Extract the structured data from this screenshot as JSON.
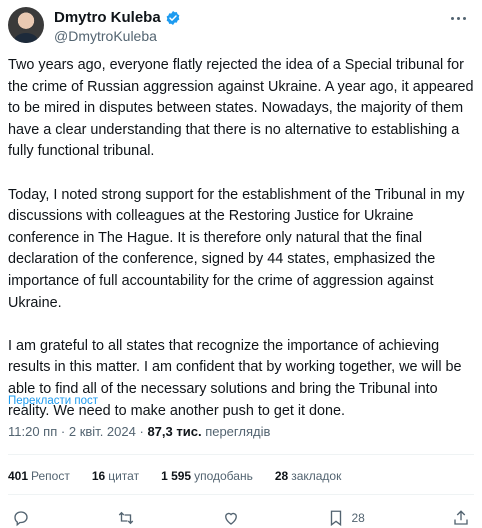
{
  "author": {
    "display_name": "Dmytro Kuleba",
    "handle": "@DmytroKuleba"
  },
  "tweet": {
    "paragraphs": [
      "Two years ago, everyone flatly rejected the idea of a Special tribunal for the crime of Russian aggression against Ukraine. A year ago, it appeared to be mired in disputes between states. Nowadays, the majority of them have a clear understanding that there is no alternative to establishing a fully functional tribunal.",
      "Today, I noted strong support for the establishment of the Tribunal in my discussions with colleagues at the Restoring Justice for Ukraine conference in The Hague. It is therefore only natural that the final declaration of the conference, signed by 44 states, emphasized the importance of full accountability for the crime of aggression against Ukraine.",
      "I am grateful to all states that recognize the importance of achieving results in this matter. I am confident that by working together, we will be able to find all of the necessary solutions and bring the Tribunal into reality. We need to make another push to get it done."
    ],
    "translate_label": "Перекласти пост",
    "time": "11:20 пп",
    "separator": "·",
    "date": "2 квіт. 2024",
    "views_count": "87,3 тис.",
    "views_label": "переглядів"
  },
  "stats": {
    "reposts_count": "401",
    "reposts_label": "Репост",
    "quotes_count": "16",
    "quotes_label": "цитат",
    "likes_count": "1 595",
    "likes_label": "уподобань",
    "bookmarks_count": "28",
    "bookmarks_label": "закладок"
  },
  "actions": {
    "bookmark_count": "28"
  },
  "icons": [
    "verified-badge-icon",
    "more-icon",
    "reply-icon",
    "repost-icon",
    "like-icon",
    "bookmark-icon",
    "share-icon"
  ],
  "colors": {
    "accent": "#1d9bf0",
    "secondary_text": "#536471",
    "divider": "#eff3f4"
  }
}
